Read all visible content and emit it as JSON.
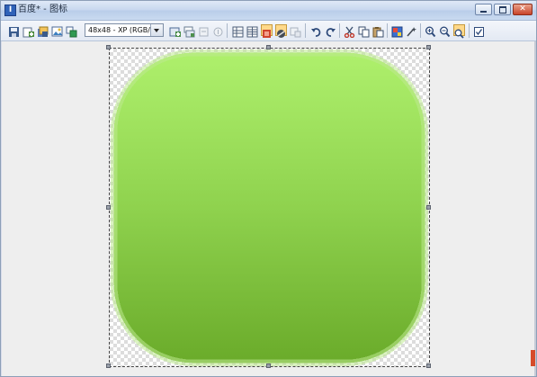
{
  "window": {
    "app_icon_glyph": "I",
    "title": "百度* - 图标",
    "minimize_label": "Minimize",
    "maximize_label": "Maximize",
    "close_glyph": "✕"
  },
  "toolbar": {
    "format_select_value": "48x48 - XP (RGB/A)",
    "buttons": [
      {
        "name": "save-icon",
        "color": "#3a5b8c"
      },
      {
        "name": "new-image-icon",
        "color": "#4a8a3a"
      },
      {
        "name": "open-icon",
        "color": "#5a7fbf"
      },
      {
        "name": "import-image-icon",
        "color": "#3c7fbf"
      },
      {
        "name": "export-icon",
        "color": "#2f9a52"
      },
      {
        "name": "add-format-icon",
        "color": "#4d8f4d"
      },
      {
        "name": "new-format-icon",
        "color": "#6a7c92"
      },
      {
        "name": "delete-format-icon",
        "color": "#9aa3b0"
      },
      {
        "name": "format-properties-icon",
        "color": "#9aa3b0"
      },
      {
        "name": "grid-icon",
        "color": "#4d5f7a"
      },
      {
        "name": "tile-icon",
        "color": "#4d5f7a"
      },
      {
        "name": "color-mode-icon",
        "color": "#d0442d"
      },
      {
        "name": "background-icon",
        "color": "#444b55"
      },
      {
        "name": "frame-icon",
        "color": "#9aa3b0"
      },
      {
        "name": "undo-icon",
        "color": "#2e4a7a"
      },
      {
        "name": "redo-icon",
        "color": "#2e4a7a"
      },
      {
        "name": "cut-icon",
        "color": "#c13a2c"
      },
      {
        "name": "copy-icon",
        "color": "#3a4e6d"
      },
      {
        "name": "paste-icon",
        "color": "#3a4e6d"
      },
      {
        "name": "color-palette-icon",
        "color": "#3a6fd0"
      },
      {
        "name": "effects-icon",
        "color": "#444b55"
      },
      {
        "name": "zoom-in-icon",
        "color": "#2e4a7a"
      },
      {
        "name": "zoom-out-icon",
        "color": "#2e4a7a"
      },
      {
        "name": "zoom-fit-icon",
        "color": "#2e4a7a"
      },
      {
        "name": "checkbox-icon",
        "color": "#2e4a7a"
      }
    ]
  },
  "canvas": {
    "green_top": "#aef06c",
    "green_mid": "#8fd24e",
    "green_bottom": "#6aab2a"
  }
}
